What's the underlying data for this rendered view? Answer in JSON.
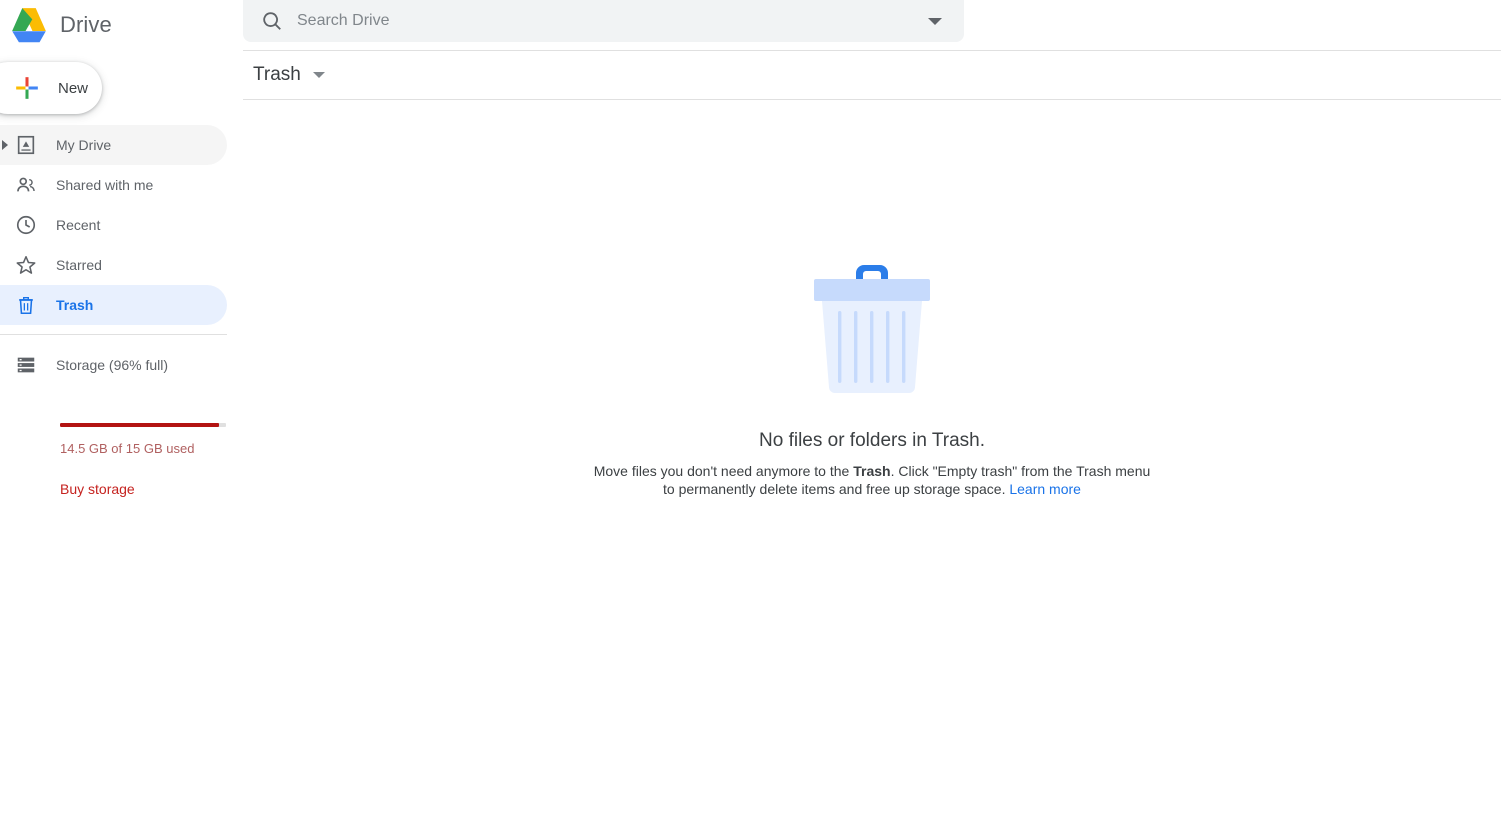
{
  "app": {
    "name": "Drive",
    "logo_icon": "google-drive-logo"
  },
  "search": {
    "placeholder": "Search Drive",
    "value": "",
    "icon": "search-icon",
    "options_icon": "chevron-down-icon"
  },
  "sidebar": {
    "new_button": {
      "label": "New",
      "icon": "plus-icon"
    },
    "items": [
      {
        "label": "My Drive",
        "icon": "my-drive-icon",
        "state": "hovered",
        "expandable": true
      },
      {
        "label": "Shared with me",
        "icon": "people-icon",
        "state": "default",
        "expandable": false
      },
      {
        "label": "Recent",
        "icon": "clock-icon",
        "state": "default",
        "expandable": false
      },
      {
        "label": "Starred",
        "icon": "star-icon",
        "state": "default",
        "expandable": false
      },
      {
        "label": "Trash",
        "icon": "trash-icon",
        "state": "selected",
        "expandable": false
      }
    ],
    "storage": {
      "icon": "storage-icon",
      "label": "Storage (96% full)",
      "percent_full": 96,
      "used_text": "14.5 GB of 15 GB used",
      "buy_link": "Buy storage",
      "bar_fill_color": "#b31412",
      "bar_track_color": "#e0e0e0"
    }
  },
  "content": {
    "title": "Trash",
    "title_caret_icon": "chevron-down-icon",
    "empty_state": {
      "illustration": "trash-can-illustration",
      "title": "No files or folders in Trash.",
      "desc_part1": "Move files you don't need anymore to the ",
      "desc_bold": "Trash",
      "desc_part2": ". Click \"Empty trash\" from the Trash menu to permanently delete items and free up storage space. ",
      "learn_more": "Learn more"
    }
  },
  "colors": {
    "accent_blue": "#1a73e8",
    "selected_bg": "#e8f0fe",
    "hover_bg": "#f5f5f5",
    "search_bg": "#f1f3f4",
    "storage_red": "#b31412",
    "buy_storage_red": "#c5221f",
    "text_primary": "#3c4043",
    "text_secondary": "#5f6368"
  }
}
